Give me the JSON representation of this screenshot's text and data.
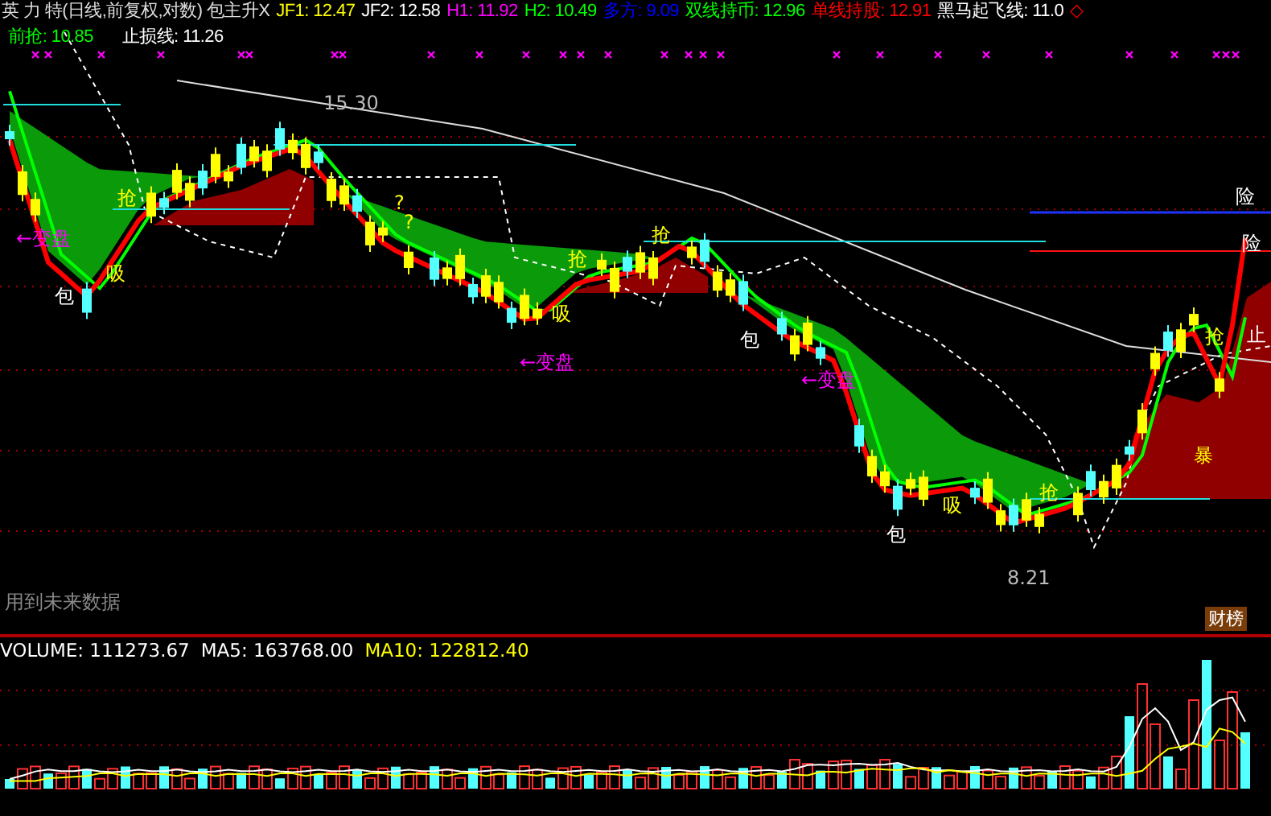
{
  "header": {
    "title": "英 力 特(日线,前复权,对数) 包主升X",
    "indicators": [
      {
        "text": "JF1: 12.47",
        "color": "#ffff00"
      },
      {
        "text": "JF2: 12.58",
        "color": "#ffffff"
      },
      {
        "text": "H1: 11.92",
        "color": "#ff00ff"
      },
      {
        "text": "H2: 10.49",
        "color": "#00ff00"
      },
      {
        "text": "多方: 9.09",
        "color": "#0000ff"
      },
      {
        "text": "双线持币: 12.96",
        "color": "#00ff00"
      },
      {
        "text": "单线持股: 12.91",
        "color": "#ff0000"
      },
      {
        "text": "黑马起飞线: 11.0",
        "color": "#ffffff"
      }
    ],
    "end_mark": "◇",
    "lines": [
      {
        "text": "前抢: 10.85",
        "color": "#00ff00"
      },
      {
        "text": "止损线: 11.26",
        "color": "#ffffff"
      }
    ]
  },
  "chart": {
    "high_label": "15.30",
    "low_label": "8.21",
    "note": "用到未来数据",
    "badge": "财榜",
    "annotations": [
      {
        "kind": "turn",
        "text": "←变盘"
      },
      {
        "kind": "turn",
        "text": "←变盘"
      },
      {
        "kind": "turn",
        "text": "←变盘"
      },
      {
        "kind": "grab",
        "text": "抢"
      },
      {
        "kind": "grab",
        "text": "抢"
      },
      {
        "kind": "grab",
        "text": "抢"
      },
      {
        "kind": "grab",
        "text": "抢"
      },
      {
        "kind": "grab",
        "text": "抢"
      },
      {
        "kind": "wrap",
        "text": "包"
      },
      {
        "kind": "wrap",
        "text": "包"
      },
      {
        "kind": "wrap",
        "text": "包"
      },
      {
        "kind": "absorb",
        "text": "吸"
      },
      {
        "kind": "absorb",
        "text": "吸"
      },
      {
        "kind": "absorb",
        "text": "吸"
      },
      {
        "kind": "risk",
        "text": "险"
      },
      {
        "kind": "risk",
        "text": "险"
      },
      {
        "kind": "burst",
        "text": "暴"
      },
      {
        "kind": "stop",
        "text": "止"
      },
      {
        "kind": "doubt",
        "text": "?"
      },
      {
        "kind": "doubt",
        "text": "?"
      }
    ]
  },
  "volume": {
    "readings": [
      {
        "text": "VOLUME: 111273.67",
        "color": "#ffffff"
      },
      {
        "text": "MA5: 163768.00",
        "color": "#ffffff"
      },
      {
        "text": "MA10: 122812.40",
        "color": "#ffff00"
      }
    ]
  }
}
